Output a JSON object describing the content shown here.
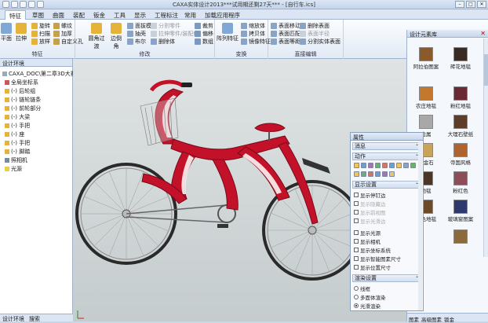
{
  "app": {
    "title": "CAXA实体设计2013***试用期还剩27天*** - [自行车.ics]",
    "style_label": "样式"
  },
  "tabs": [
    {
      "label": "特征",
      "active": true
    },
    {
      "label": "草图"
    },
    {
      "label": "曲面"
    },
    {
      "label": "装配"
    },
    {
      "label": "钣金"
    },
    {
      "label": "工具"
    },
    {
      "label": "显示"
    },
    {
      "label": "工程标注"
    },
    {
      "label": "常用"
    },
    {
      "label": "加载应用程序"
    }
  ],
  "ribbon": {
    "group_feature": {
      "label": "特征",
      "items": [
        "平面",
        "拉伸",
        "旋转",
        "扫描",
        "放样",
        "螺纹",
        "加厚",
        "自定义孔"
      ]
    },
    "group_modify": {
      "label": "修改",
      "items": [
        "圆角过渡",
        "边倒角",
        "面拔模",
        "抽壳",
        "布尔",
        "分割零件",
        "拉伸零件/装配体",
        "删除体",
        "裁剪",
        "偏移",
        "数组"
      ]
    },
    "group_transform": {
      "label": "变换",
      "items": [
        "阵列特征",
        "缩放体",
        "拷贝体",
        "镜像特征"
      ]
    },
    "group_direct": {
      "label": "直接编辑",
      "items": [
        "表面移动",
        "表面匹配",
        "表面等距",
        "删除表面",
        "表面半径",
        "分割实体表面"
      ]
    }
  },
  "left_panel": {
    "header": "设计环境",
    "tree": [
      "CAXA_DOC\\第二章3D大赛作品",
      "全局坐标系",
      "(-) 后轮组",
      "(-) 链轮链条",
      "(-) 前轮部分",
      "(-) 大梁",
      "(-) 手把",
      "(-) 座",
      "(-) 手把",
      "(-) 脚踏",
      "照相机",
      "光源"
    ],
    "tabs": [
      "设计环境",
      "搜索"
    ]
  },
  "right_panel": {
    "header": "设计元素库",
    "tiles": [
      {
        "label": "阿拉伯图案",
        "color": "#8a5a2b"
      },
      {
        "label": "砖花地毯",
        "color": "#3a2a22"
      },
      {
        "label": "农庄地毯",
        "color": "#c4782e"
      },
      {
        "label": "粉红地毯",
        "color": "#6b2a33"
      },
      {
        "label": "金属",
        "color": "#a8a8a8"
      },
      {
        "label": "大理石壁纸",
        "color": "#5e3d28"
      },
      {
        "label": "黄金石",
        "color": "#c9a35a"
      },
      {
        "label": "帝国风格",
        "color": "#b0632f"
      },
      {
        "label": "地毯",
        "color": "#4a3628"
      },
      {
        "label": "粉红色",
        "color": "#8c4f5a"
      },
      {
        "label": "黄色地毯",
        "color": "#6b4a2a"
      },
      {
        "label": "玻璃窗图案",
        "color": "#2e3a6e"
      },
      {
        "label": "",
        "color": "#8c6a3a"
      }
    ],
    "tabs": [
      "图素",
      "高级图素",
      "钣金"
    ]
  },
  "properties": {
    "header": "属性",
    "sections": {
      "messages": "消息",
      "actions": "动作",
      "display": "显示设置",
      "render": "渲染设置"
    },
    "display_options": [
      {
        "label": "显示停钉边",
        "checked": false,
        "enabled": true
      },
      {
        "label": "显示隐藏边",
        "checked": false,
        "enabled": false
      },
      {
        "label": "显示前视图",
        "checked": false,
        "enabled": false
      },
      {
        "label": "显示光滑边",
        "checked": false,
        "enabled": false
      },
      {
        "label": "显示光源",
        "checked": false,
        "enabled": true
      },
      {
        "label": "显示相机",
        "checked": false,
        "enabled": true
      },
      {
        "label": "显示坐标系统",
        "checked": false,
        "enabled": true
      },
      {
        "label": "显示智能图素尺寸",
        "checked": false,
        "enabled": true
      },
      {
        "label": "显示位置尺寸",
        "checked": false,
        "enabled": true
      }
    ],
    "render_options": [
      {
        "label": "线框",
        "selected": false
      },
      {
        "label": "多面体渲染",
        "selected": false
      },
      {
        "label": "光滑渲染",
        "selected": true
      }
    ]
  }
}
